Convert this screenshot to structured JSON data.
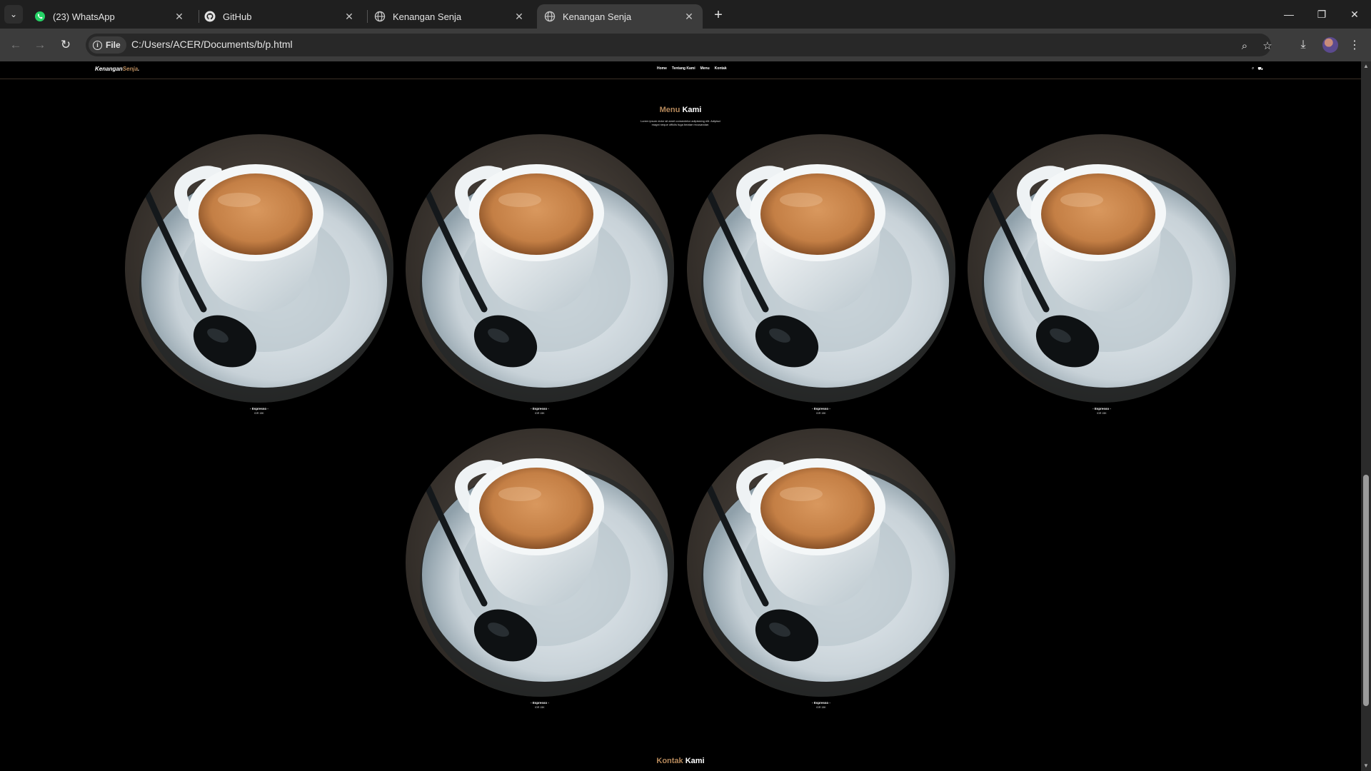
{
  "browser": {
    "tabs": [
      {
        "title": "(23) WhatsApp",
        "icon": "whatsapp-icon",
        "active": false
      },
      {
        "title": "GitHub",
        "icon": "github-icon",
        "active": false
      },
      {
        "title": "Kenangan Senja",
        "icon": "globe-icon",
        "active": false
      },
      {
        "title": "Kenangan Senja",
        "icon": "globe-icon",
        "active": true
      }
    ],
    "chip_label": "File",
    "url": "C:/Users/ACER/Documents/b/p.html"
  },
  "site": {
    "logo": {
      "main": "Kenangan",
      "accent": "Senja",
      "dot": "."
    },
    "nav": [
      "Home",
      "Tentang Kami",
      "Menu",
      "Kontak"
    ],
    "menu_section": {
      "title_accent": "Menu",
      "title_main": "Kami",
      "description": "Lorem ipsum dolor sit amet consectetur adipisicing elit. Adipisci magni neque officiis fuga beatae recusandae."
    },
    "items": [
      {
        "name": "- Espresso -",
        "price": "IDR 15K"
      },
      {
        "name": "- Espresso -",
        "price": "IDR 15K"
      },
      {
        "name": "- Espresso -",
        "price": "IDR 15K"
      },
      {
        "name": "- Espresso -",
        "price": "IDR 15K"
      },
      {
        "name": "- Espresso -",
        "price": "IDR 15K"
      },
      {
        "name": "- Espresso -",
        "price": "IDR 15K"
      }
    ],
    "contact_section": {
      "title_accent": "Kontak",
      "title_main": "Kami"
    }
  },
  "colors": {
    "accent": "#b6895b",
    "background": "#000000",
    "chrome": "#1f1f1f",
    "toolbar": "#3c3c3c"
  }
}
